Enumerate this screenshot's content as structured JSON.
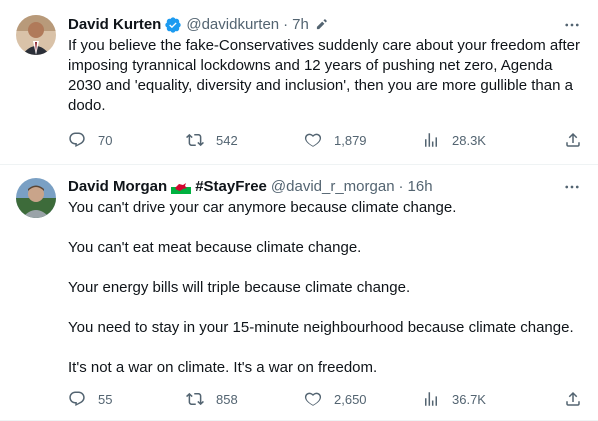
{
  "tweets": [
    {
      "name": "David Kurten",
      "handle": "@davidkurten",
      "time": "7h",
      "text": [
        "If you believe the fake-Conservatives suddenly care about your freedom after imposing tyrannical lockdowns and 12 years of pushing net zero, Agenda 2030 and 'equality, diversity and inclusion', then you are more gullible than a dodo."
      ],
      "replies": "70",
      "retweets": "542",
      "likes": "1,879",
      "views": "28.3K"
    },
    {
      "name": "David Morgan",
      "hashtag": "#StayFree",
      "handle": "@david_r_morgan",
      "time": "16h",
      "text": [
        "You can't drive your car anymore because climate change.",
        "You can't eat meat because climate change.",
        "Your energy bills will triple because climate change.",
        "You need to stay in your 15-minute neighbourhood because climate change.",
        "It's not a war on climate. It's a war on freedom."
      ],
      "replies": "55",
      "retweets": "858",
      "likes": "2,650",
      "views": "36.7K"
    }
  ],
  "colors": {
    "accent": "#1d9bf0",
    "muted": "#536471",
    "text": "#0f1419"
  },
  "icons": [
    "verified-badge-icon",
    "edit-pencil-icon",
    "more-icon",
    "reply-icon",
    "retweet-icon",
    "like-icon",
    "views-icon",
    "share-icon",
    "wales-flag-icon"
  ]
}
